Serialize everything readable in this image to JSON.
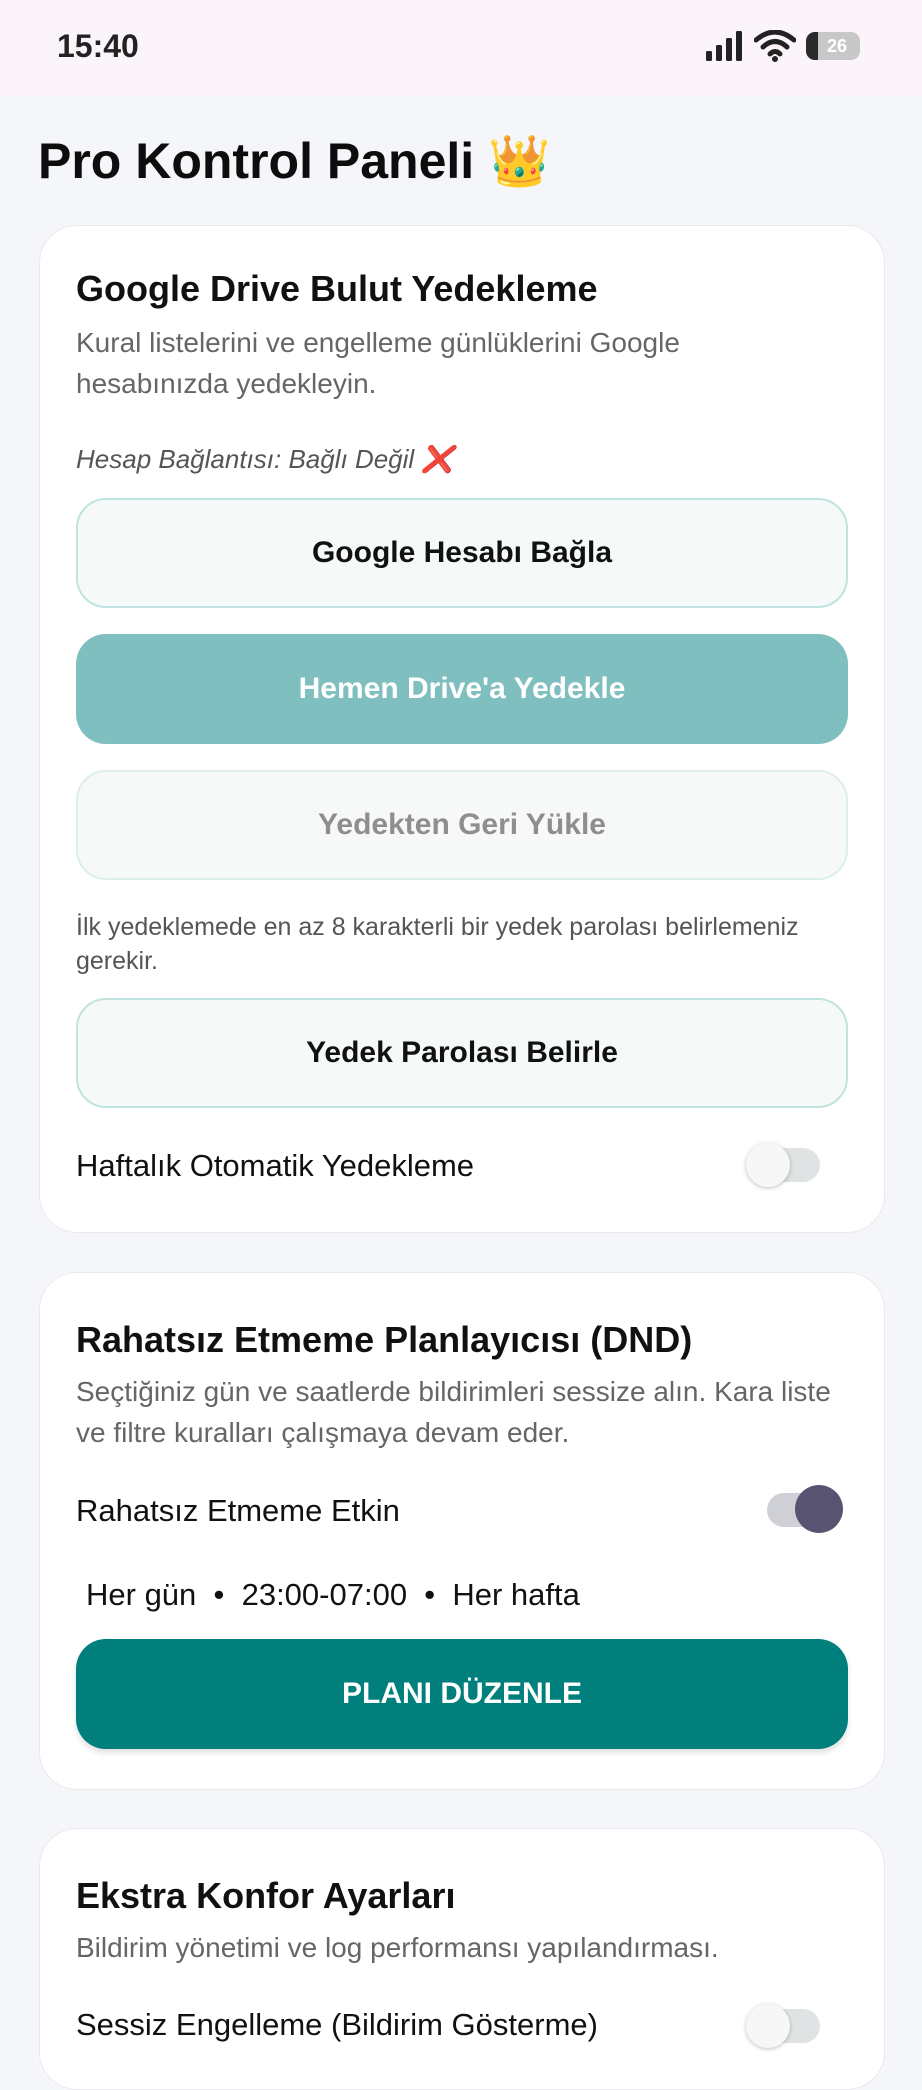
{
  "status_bar": {
    "time": "15:40",
    "battery": "26",
    "icons": [
      "signal-icon",
      "wifi-icon",
      "battery-icon"
    ]
  },
  "page_title": "Pro Kontrol Paneli 👑",
  "backup_card": {
    "title": "Google Drive Bulut Yedekleme",
    "description": "Kural listelerini ve engelleme günlüklerini Google hesabınızda yedekleyin.",
    "account_status": "Hesap Bağlantısı: Bağlı Değil ❌",
    "connect_button": "Google Hesabı Bağla",
    "backup_now_button": "Hemen Drive'a Yedekle",
    "restore_button": "Yedekten Geri Yükle",
    "password_note": "İlk yedeklemede en az 8 karakterli bir yedek parolası belirlemeniz gerekir.",
    "set_password_button": "Yedek Parolası Belirle",
    "weekly_backup_label": "Haftalık Otomatik Yedekleme",
    "weekly_backup_enabled": false
  },
  "dnd_card": {
    "title": "Rahatsız Etmeme Planlayıcısı (DND)",
    "description": "Seçtiğiniz gün ve saatlerde bildirimleri sessize alın. Kara liste ve filtre kuralları çalışmaya devam eder.",
    "enabled_label": "Rahatsız Etmeme Etkin",
    "enabled": true,
    "schedule_summary": "Her gün  •  23:00-07:00  •  Her hafta",
    "edit_button": "PLANI DÜZENLE"
  },
  "comfort_card": {
    "title": "Ekstra Konfor Ayarları",
    "description": "Bildirim yönetimi ve log performansı yapılandırması.",
    "silent_block_label": "Sessiz Engelleme (Bildirim Gösterme)",
    "silent_block_enabled": false
  },
  "colors": {
    "primary": "#007f7c",
    "primary_soft": "#80bfbf",
    "toggle_on_knob": "#575370"
  }
}
